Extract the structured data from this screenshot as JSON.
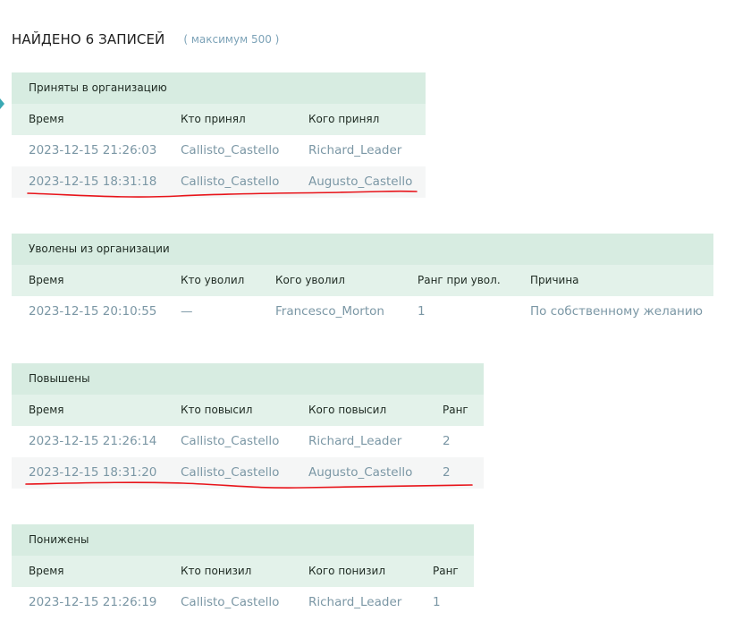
{
  "header": {
    "title": "НАЙДЕНО 6 ЗАПИСЕЙ",
    "max_note": "( максимум 500 )"
  },
  "colors": {
    "title_bg": "#d7ece1",
    "header_bg": "#e3f2ea",
    "row_alt_bg": "#f5f6f6",
    "cell_text": "#7b97a5",
    "underline": "#e8141a",
    "marker": "#3aa9b4"
  },
  "accepted": {
    "title": "Приняты в организацию",
    "columns": [
      "Время",
      "Кто принял",
      "Кого принял"
    ],
    "rows": [
      [
        "2023-12-15 21:26:03",
        "Callisto_Castello",
        "Richard_Leader"
      ],
      [
        "2023-12-15 18:31:18",
        "Callisto_Castello",
        "Augusto_Castello"
      ]
    ]
  },
  "fired": {
    "title": "Уволены из организации",
    "columns": [
      "Время",
      "Кто уволил",
      "Кого уволил",
      "Ранг при увол.",
      "Причина"
    ],
    "rows": [
      [
        "2023-12-15 20:10:55",
        "—",
        "Francesco_Morton",
        "1",
        "По собственному желанию"
      ]
    ]
  },
  "promoted": {
    "title": "Повышены",
    "columns": [
      "Время",
      "Кто повысил",
      "Кого повысил",
      "Ранг"
    ],
    "rows": [
      [
        "2023-12-15 21:26:14",
        "Callisto_Castello",
        "Richard_Leader",
        "2"
      ],
      [
        "2023-12-15 18:31:20",
        "Callisto_Castello",
        "Augusto_Castello",
        "2"
      ]
    ]
  },
  "demoted": {
    "title": "Понижены",
    "columns": [
      "Время",
      "Кто понизил",
      "Кого понизил",
      "Ранг"
    ],
    "rows": [
      [
        "2023-12-15 21:26:19",
        "Callisto_Castello",
        "Richard_Leader",
        "1"
      ]
    ]
  }
}
